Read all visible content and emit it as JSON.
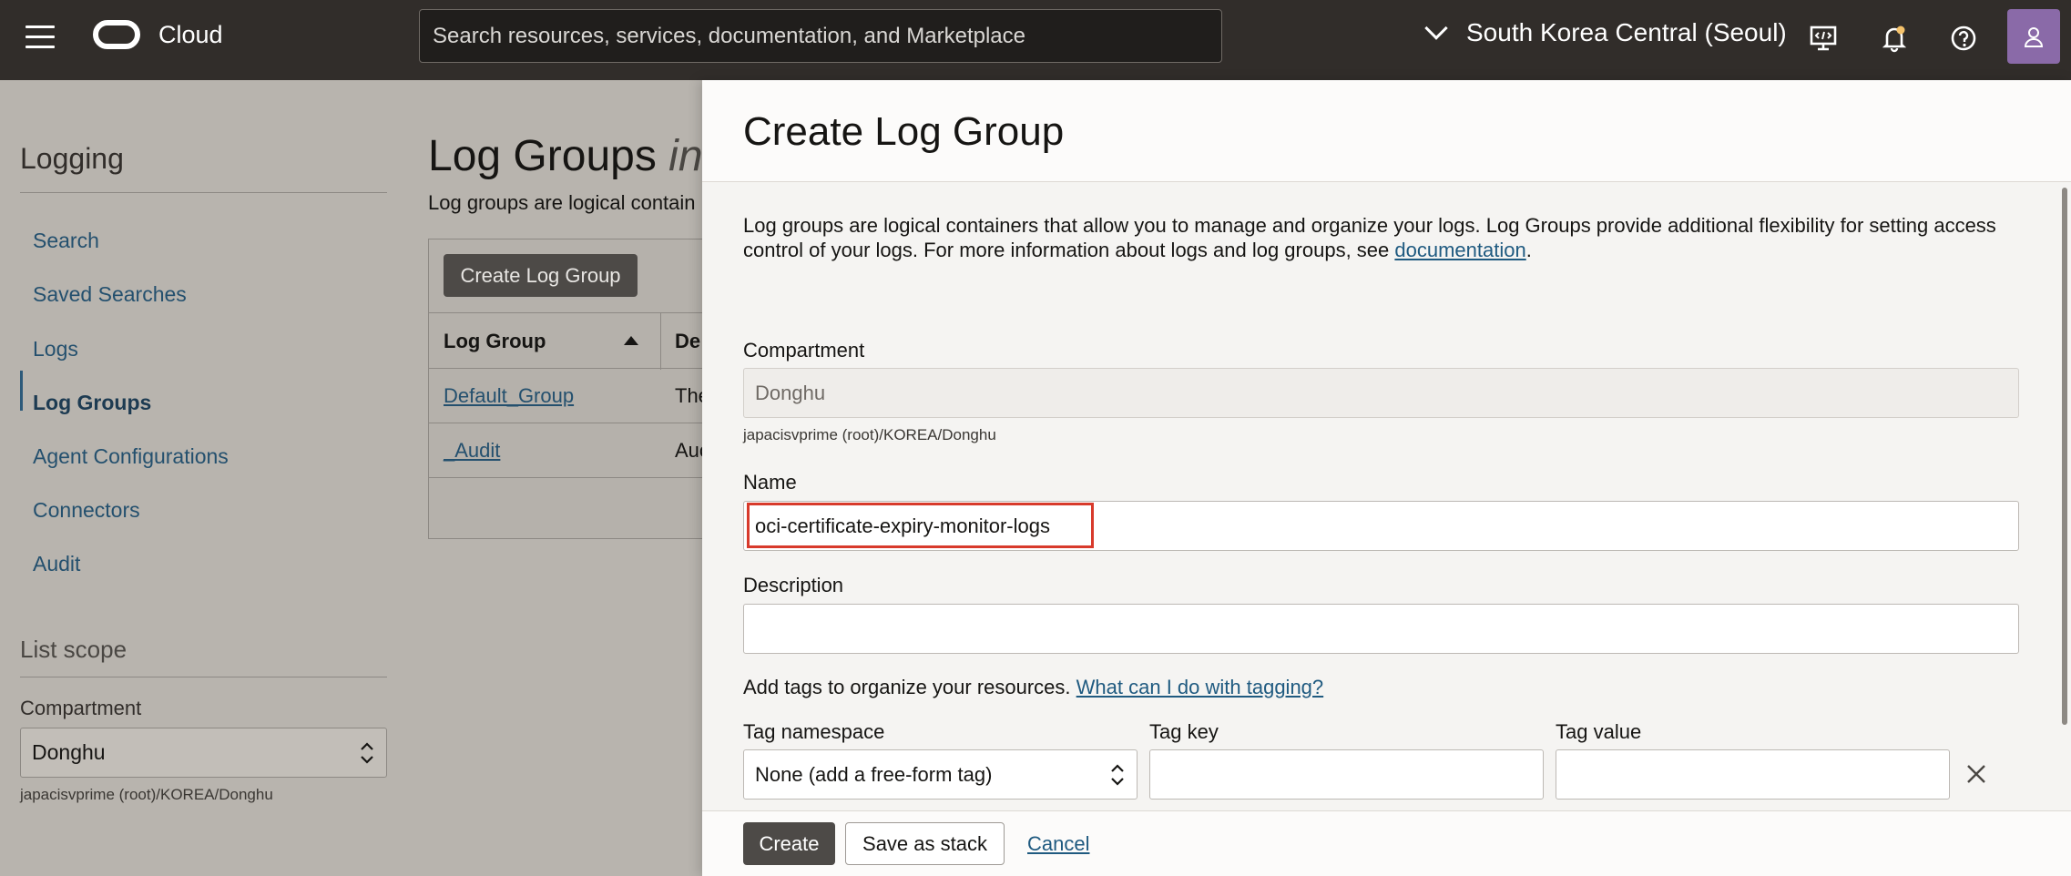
{
  "topbar": {
    "brand": "Cloud",
    "search_placeholder": "Search resources, services, documentation, and Marketplace",
    "region": "South Korea Central (Seoul)",
    "icons": [
      "menu-icon",
      "cloud-shell-icon",
      "bell-icon",
      "help-icon",
      "profile-icon"
    ]
  },
  "sidebar": {
    "title": "Logging",
    "items": [
      {
        "label": "Search"
      },
      {
        "label": "Saved Searches"
      },
      {
        "label": "Logs"
      },
      {
        "label": "Log Groups",
        "active": true
      },
      {
        "label": "Agent Configurations"
      },
      {
        "label": "Connectors"
      },
      {
        "label": "Audit"
      }
    ],
    "scope_title": "List scope",
    "compartment_label": "Compartment",
    "compartment_value": "Donghu",
    "compartment_path": "japacisvprime (root)/KOREA/Donghu"
  },
  "main": {
    "title": "Log Groups",
    "title_italic": "in",
    "description": "Log groups are logical contain",
    "create_button": "Create Log Group",
    "columns": [
      "Log Group",
      "De"
    ],
    "rows": [
      {
        "name": "Default_Group",
        "desc": "The"
      },
      {
        "name": "_Audit",
        "desc": "Auc"
      }
    ]
  },
  "drawer": {
    "title": "Create Log Group",
    "intro": "Log groups are logical containers that allow you to manage and organize your logs. Log Groups provide additional flexibility for setting access control of your logs. For more information about logs and log groups, see ",
    "intro_link": "documentation",
    "intro_end": ".",
    "compartment_label": "Compartment",
    "compartment_value": "Donghu",
    "compartment_path": "japacisvprime (root)/KOREA/Donghu",
    "name_label": "Name",
    "name_value": "oci-certificate-expiry-monitor-logs",
    "description_label": "Description",
    "description_value": "",
    "tags_text": "Add tags to organize your resources. ",
    "tags_link": "What can I do with tagging?",
    "tag_namespace_label": "Tag namespace",
    "tag_namespace_value": "None (add a free-form tag)",
    "tag_key_label": "Tag key",
    "tag_key_value": "",
    "tag_value_label": "Tag value",
    "tag_value_value": "",
    "buttons": {
      "create": "Create",
      "save_stack": "Save as stack",
      "cancel": "Cancel"
    }
  },
  "colors": {
    "topbar": "#312d2a",
    "link": "#1f5a80",
    "highlight": "#d83a2b",
    "primary_button": "#4d4a47"
  }
}
